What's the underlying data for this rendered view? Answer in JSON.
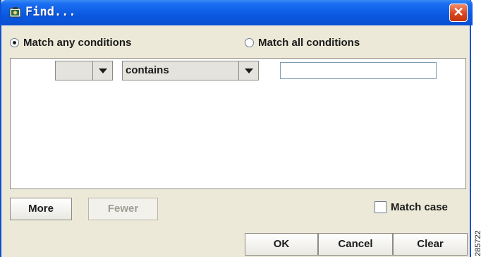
{
  "window": {
    "title": "Find...",
    "app_icon": "find-app-icon",
    "close_icon": "close-icon",
    "close_glyph": "✕",
    "colors": {
      "titlebar": "#0a58e0",
      "close_button": "#d9461f",
      "window_background": "#ece9d8"
    }
  },
  "match_mode": {
    "options": [
      {
        "label": "Match any conditions",
        "checked": true
      },
      {
        "label": "Match all conditions",
        "checked": false
      }
    ]
  },
  "condition": {
    "field_select": {
      "value": ""
    },
    "operator_select": {
      "value": "contains"
    },
    "value_input": {
      "value": "",
      "placeholder": ""
    }
  },
  "buttons": {
    "more": "More",
    "fewer": "Fewer",
    "ok": "OK",
    "cancel": "Cancel",
    "clear": "Clear"
  },
  "match_case": {
    "label": "Match case",
    "checked": false
  },
  "figure_number": "285722"
}
